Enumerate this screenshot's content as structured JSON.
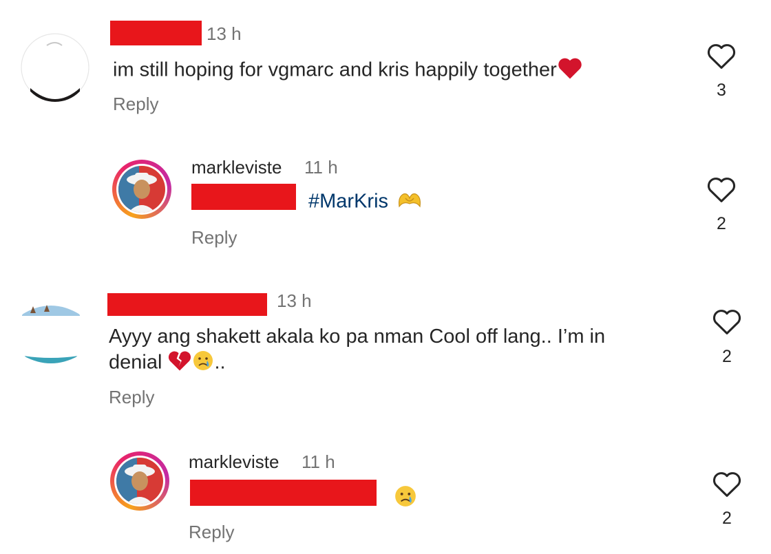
{
  "comments": [
    {
      "time": "13 h",
      "text": "im still hoping for vgmarc and kris happily together",
      "reply_label": "Reply",
      "likes": "3"
    },
    {
      "username": "markleviste",
      "time": "11 h",
      "hashtag": "#MarKris",
      "reply_label": "Reply",
      "likes": "2"
    },
    {
      "time": "13 h",
      "text_line1": "Ayyy ang  shakett akala ko pa nman Cool off lang.. I’m in",
      "text_line2": "denial",
      "text_suffix": "..",
      "reply_label": "Reply",
      "likes": "2"
    },
    {
      "username": "markleviste",
      "time": "11 h",
      "reply_label": "Reply",
      "likes": "2"
    }
  ],
  "icons": {
    "like": "heart-outline-icon",
    "emoji_heart": "red-heart-icon",
    "emoji_broken_heart": "broken-heart-icon",
    "emoji_crying": "crying-face-icon",
    "emoji_heart_hands": "heart-hands-icon"
  },
  "colors": {
    "redaction": "#e8161b",
    "hashtag": "#00376b",
    "secondary_text": "#737373"
  }
}
